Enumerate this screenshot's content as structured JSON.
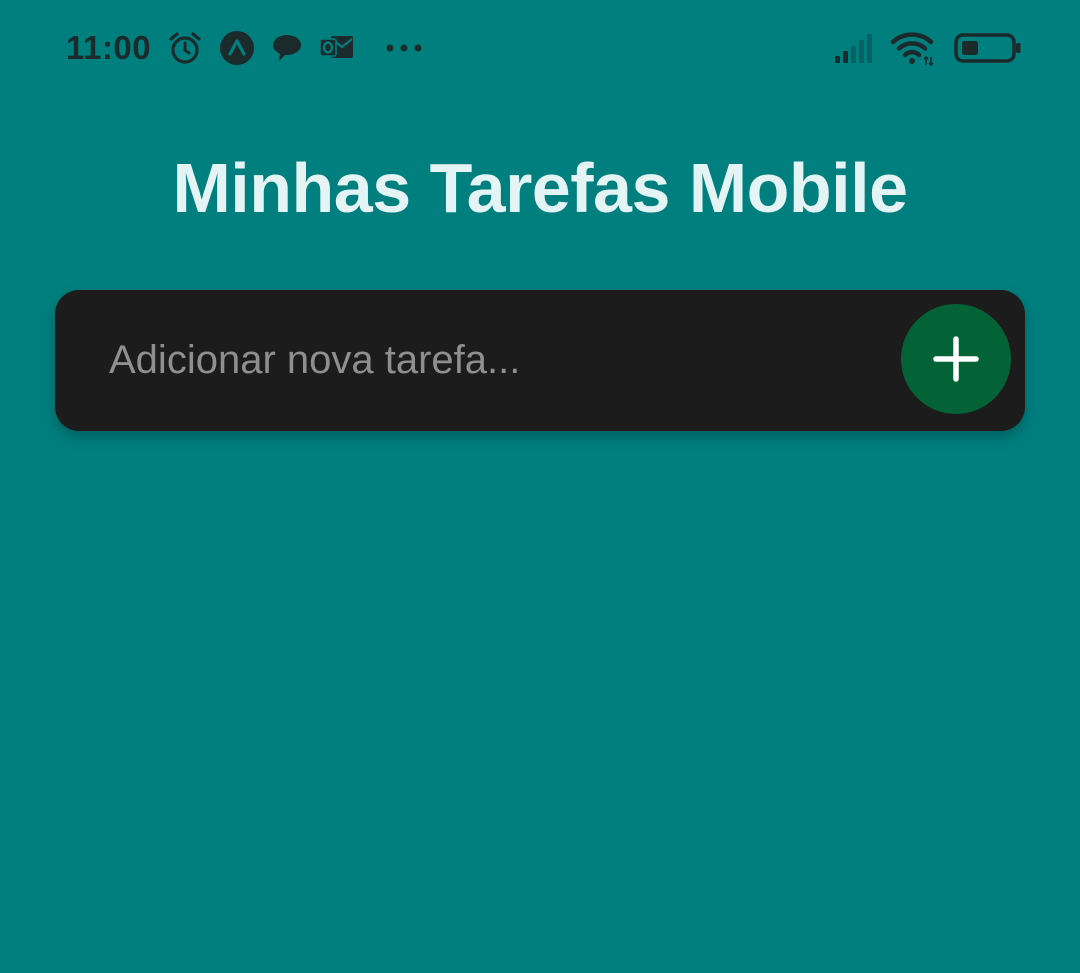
{
  "status_bar": {
    "time": "11:00",
    "notification_icons": [
      "alarm-icon",
      "app-a-icon",
      "chat-bubble-icon",
      "outlook-icon",
      "more-dots-icon"
    ],
    "system_icons": [
      "signal-icon",
      "wifi-icon",
      "battery-icon"
    ],
    "battery_level": 0.35
  },
  "header": {
    "title": "Minhas Tarefas Mobile"
  },
  "task_form": {
    "input_value": "",
    "input_placeholder": "Adicionar nova tarefa...",
    "add_button_icon": "plus-icon"
  },
  "colors": {
    "background": "#007F7F",
    "card": "#1C1C1C",
    "add_button": "#046237",
    "title": "#E4F3F3",
    "placeholder": "#8F8F8F"
  }
}
